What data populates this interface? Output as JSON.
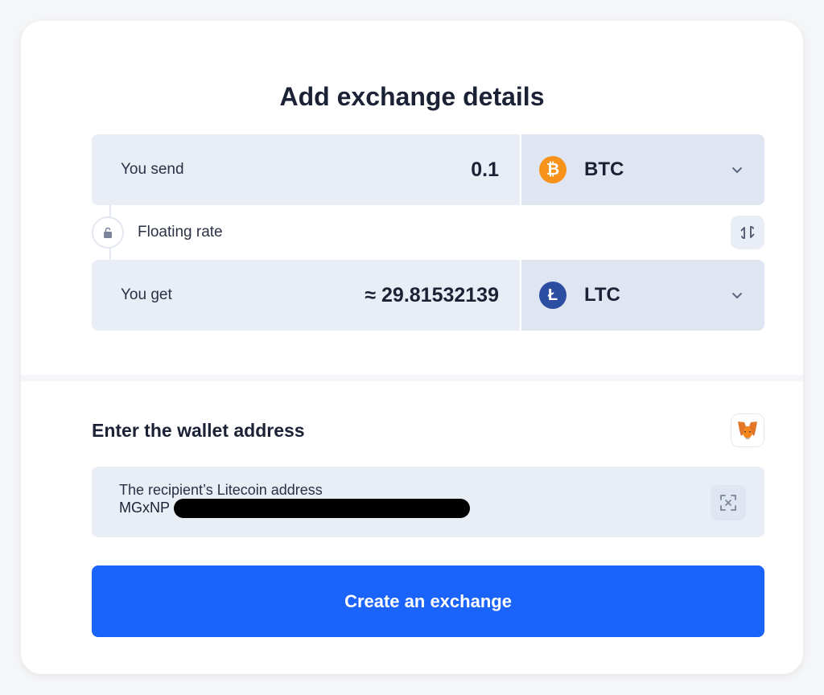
{
  "title": "Add exchange details",
  "send": {
    "label": "You send",
    "amount": "0.1",
    "currency": "BTC",
    "coin_icon": "bitcoin-icon",
    "coin_symbol": "₿",
    "coin_color": "#f7931a"
  },
  "rate": {
    "label": "Floating rate",
    "lock_icon": "lock-icon",
    "swap_icon": "swap-icon"
  },
  "get": {
    "label": "You get",
    "amount": "≈ 29.81532139",
    "currency": "LTC",
    "coin_icon": "litecoin-icon",
    "coin_symbol": "Ł",
    "coin_color": "#2c4ea2"
  },
  "wallet": {
    "heading": "Enter the wallet address",
    "metamask_icon": "metamask-icon",
    "field_label": "The recipient’s Litecoin address",
    "address_value": "MGxNP",
    "scan_icon": "qr-scan-icon"
  },
  "create_button": "Create an exchange",
  "colors": {
    "accent": "#1a63fb",
    "field_bg": "#e8edf6",
    "currency_bg": "#dfe5f1",
    "text_dark": "#1b2236"
  }
}
